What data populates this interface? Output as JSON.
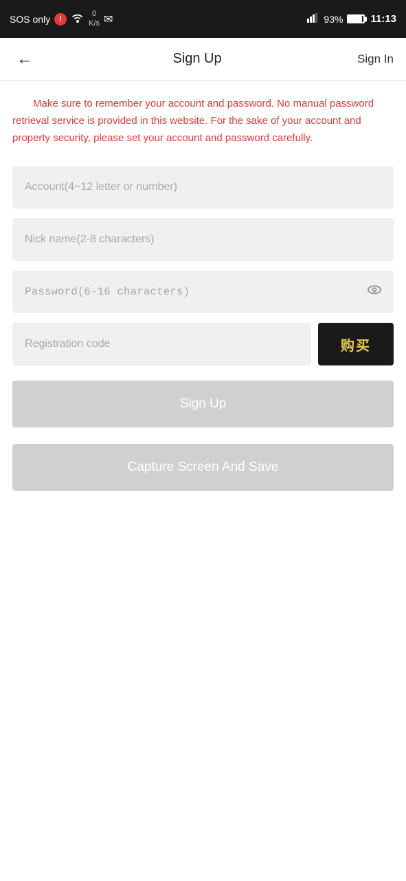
{
  "statusBar": {
    "sosLabel": "SOS only",
    "alertSymbol": "!",
    "speedLabel": "0\nK/s",
    "batteryPercent": "93%",
    "time": "11:13"
  },
  "navbar": {
    "title": "Sign Up",
    "signinLabel": "Sign In",
    "backArrow": "←"
  },
  "warning": {
    "text": "Make sure to remember your account and password. No manual password retrieval service is provided in this website. For the sake of your account and property security, please set your account and password carefully."
  },
  "form": {
    "accountPlaceholder": "Account(4~12 letter or number)",
    "nicknamePlaceholder": "Nick name(2-8 characters)",
    "passwordPlaceholder": "Password(6-16 characters)",
    "regcodePlaceholder": "Registration code",
    "buyLabel": "购买",
    "signupLabel": "Sign Up",
    "captureLabel": "Capture Screen And Save"
  }
}
